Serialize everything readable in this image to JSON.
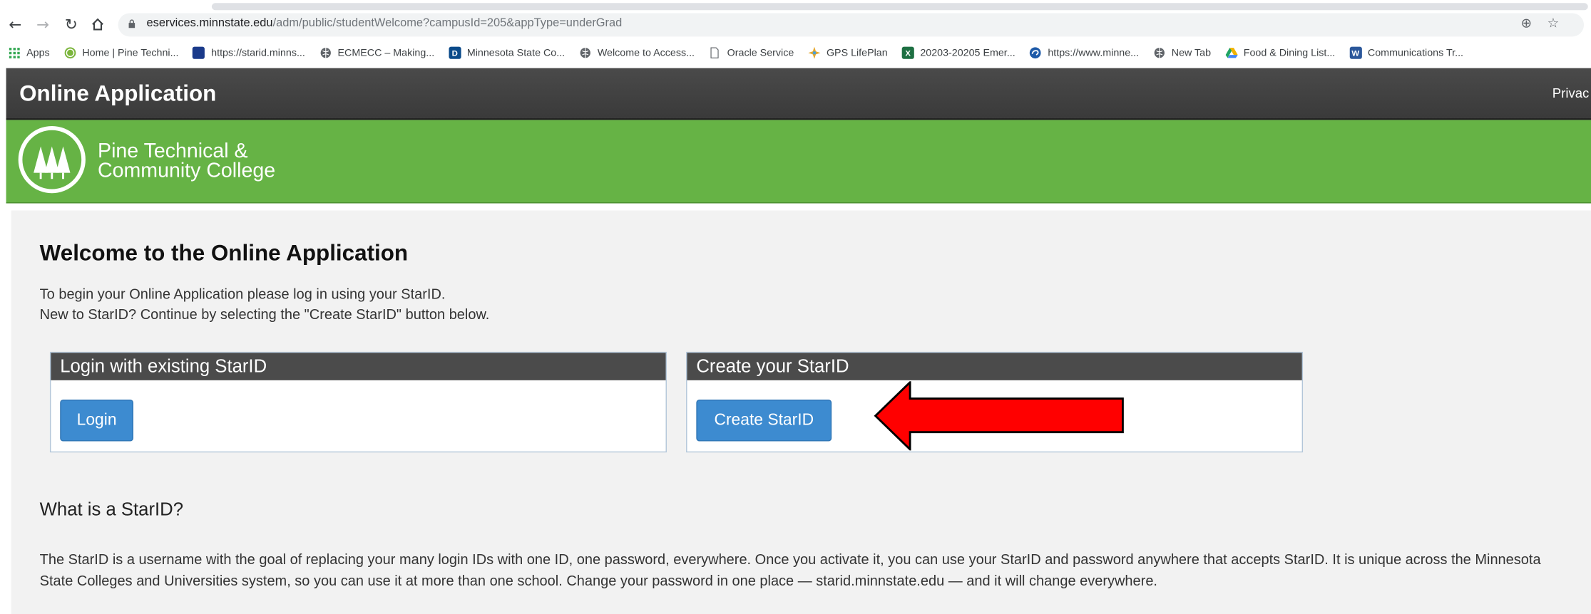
{
  "browser": {
    "url_host": "eservices.minnstate.edu",
    "url_path": "/adm/public/studentWelcome?campusId=205&appType=underGrad",
    "bookmarks": [
      {
        "label": "Apps",
        "icon": "apps-grid-icon",
        "color": "#e8453c"
      },
      {
        "label": "Home | Pine Techni...",
        "icon": "pine-tech-favicon",
        "color": "#7bb53c"
      },
      {
        "label": "https://starid.minns...",
        "icon": "bookmark-favicon",
        "color": "#1a3a8a"
      },
      {
        "label": "ECMECC – Making...",
        "icon": "globe-icon",
        "color": "#5f6368"
      },
      {
        "label": "Minnesota State Co...",
        "icon": "d2l-favicon",
        "color": "#0a4a8a"
      },
      {
        "label": "Welcome to Access...",
        "icon": "globe-icon",
        "color": "#5f6368"
      },
      {
        "label": "Oracle Service",
        "icon": "page-icon",
        "color": "#5f6368"
      },
      {
        "label": "GPS LifePlan",
        "icon": "gps-favicon",
        "color": "#e5a82d"
      },
      {
        "label": "20203-20205 Emer...",
        "icon": "excel-icon",
        "color": "#1d6f42"
      },
      {
        "label": "https://www.minne...",
        "icon": "edge-favicon",
        "color": "#1e5aa8"
      },
      {
        "label": "New Tab",
        "icon": "globe-icon",
        "color": "#5f6368"
      },
      {
        "label": "Food & Dining List...",
        "icon": "drive-icon",
        "color": "#f2b300"
      },
      {
        "label": "Communications Tr...",
        "icon": "word-icon",
        "color": "#2b579a"
      }
    ]
  },
  "header": {
    "title": "Online Application",
    "privacy_label": "Privac"
  },
  "brand": {
    "name_line1": "Pine Technical &",
    "name_line2": "Community College",
    "color": "#66b345"
  },
  "main": {
    "title": "Welcome to the Online Application",
    "intro_line1": "To begin your Online Application please log in using your StarID.",
    "intro_line2": "New to StarID? Continue by selecting the \"Create StarID\" button below.",
    "login_panel": {
      "heading": "Login with existing StarID",
      "button": "Login"
    },
    "create_panel": {
      "heading": "Create your StarID",
      "button": "Create StarID"
    },
    "starid_heading": "What is a StarID?",
    "starid_desc": "The StarID is a username with the goal of replacing your many login IDs with one ID, one password, everywhere. Once you activate it, you can use your StarID and password anywhere that accepts StarID. It is unique across the Minnesota State Colleges and Universities system, so you can use it at more than one school. Change your password in one place — starid.minnstate.edu — and it will change everywhere.",
    "button_color": "#3d8bd0",
    "arrow_color": "#ff0000"
  }
}
